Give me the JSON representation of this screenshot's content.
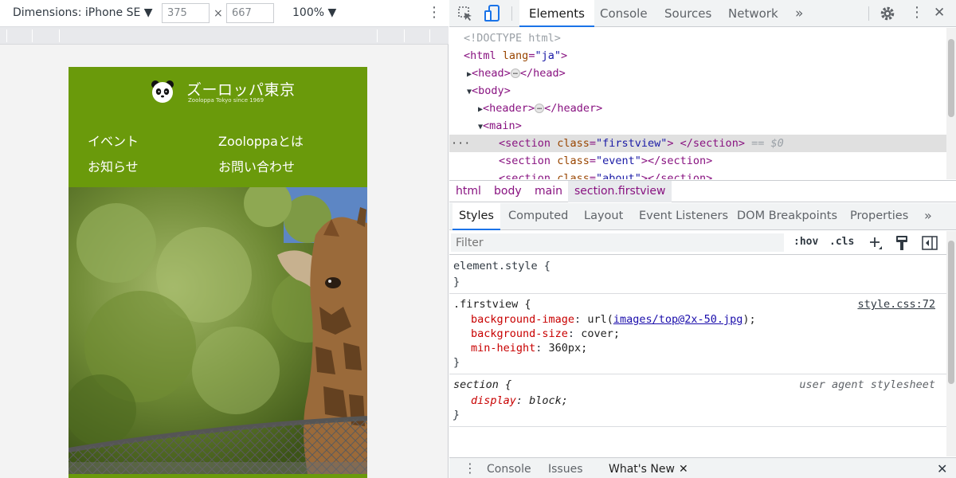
{
  "device_toolbar": {
    "dimensions_label": "Dimensions: iPhone SE ▼",
    "width": "375",
    "times": "×",
    "height": "667",
    "zoom": "100% ▼",
    "more": "⋮"
  },
  "phone": {
    "site_title": "ズーロッパ東京",
    "site_subtitle": "Zooloppa Tokyo since 1969",
    "nav": [
      "イベント",
      "Zooloppaとは",
      "お知らせ",
      "お問い合わせ"
    ]
  },
  "devtools": {
    "tabs": [
      "Elements",
      "Console",
      "Sources",
      "Network"
    ],
    "more_tabs": "»",
    "elements": {
      "doctype": "<!DOCTYPE html>",
      "html_open_tag": "html",
      "html_attr": "lang",
      "html_attr_val": "\"ja\"",
      "head": "head",
      "body": "body",
      "header": "header",
      "main": "main",
      "section_tag": "section",
      "class_attr": "class",
      "firstview_val": "\"firstview\"",
      "event_val": "\"event\"",
      "about_val": "\"about\"",
      "eq_marker": "== $0",
      "row_dots": "···",
      "ellipsis": "…"
    },
    "breadcrumbs": [
      "html",
      "body",
      "main",
      "section.firstview"
    ],
    "sub_tabs": [
      "Styles",
      "Computed",
      "Layout",
      "Event Listeners",
      "DOM Breakpoints",
      "Properties"
    ],
    "filter_placeholder": "Filter",
    "filter_hov": ":hov",
    "filter_cls": ".cls",
    "styles": {
      "element_style": "element.style {",
      "close": "}",
      "firstview_selector": ".firstview {",
      "firstview_source": "style.css:72",
      "bg_image_prop": "background-image",
      "bg_image_prefix": "url(",
      "bg_image_url": "images/top@2x-50.jpg",
      "bg_image_suffix": ");",
      "bg_size_prop": "background-size",
      "bg_size_val": "cover;",
      "min_height_prop": "min-height",
      "min_height_val": "360px;",
      "section_selector": "section {",
      "ua_label": "user agent stylesheet",
      "display_prop": "display",
      "display_val": "block;"
    },
    "drawer_tabs": [
      "Console",
      "Issues",
      "What's New"
    ],
    "drawer_close": "✕"
  }
}
